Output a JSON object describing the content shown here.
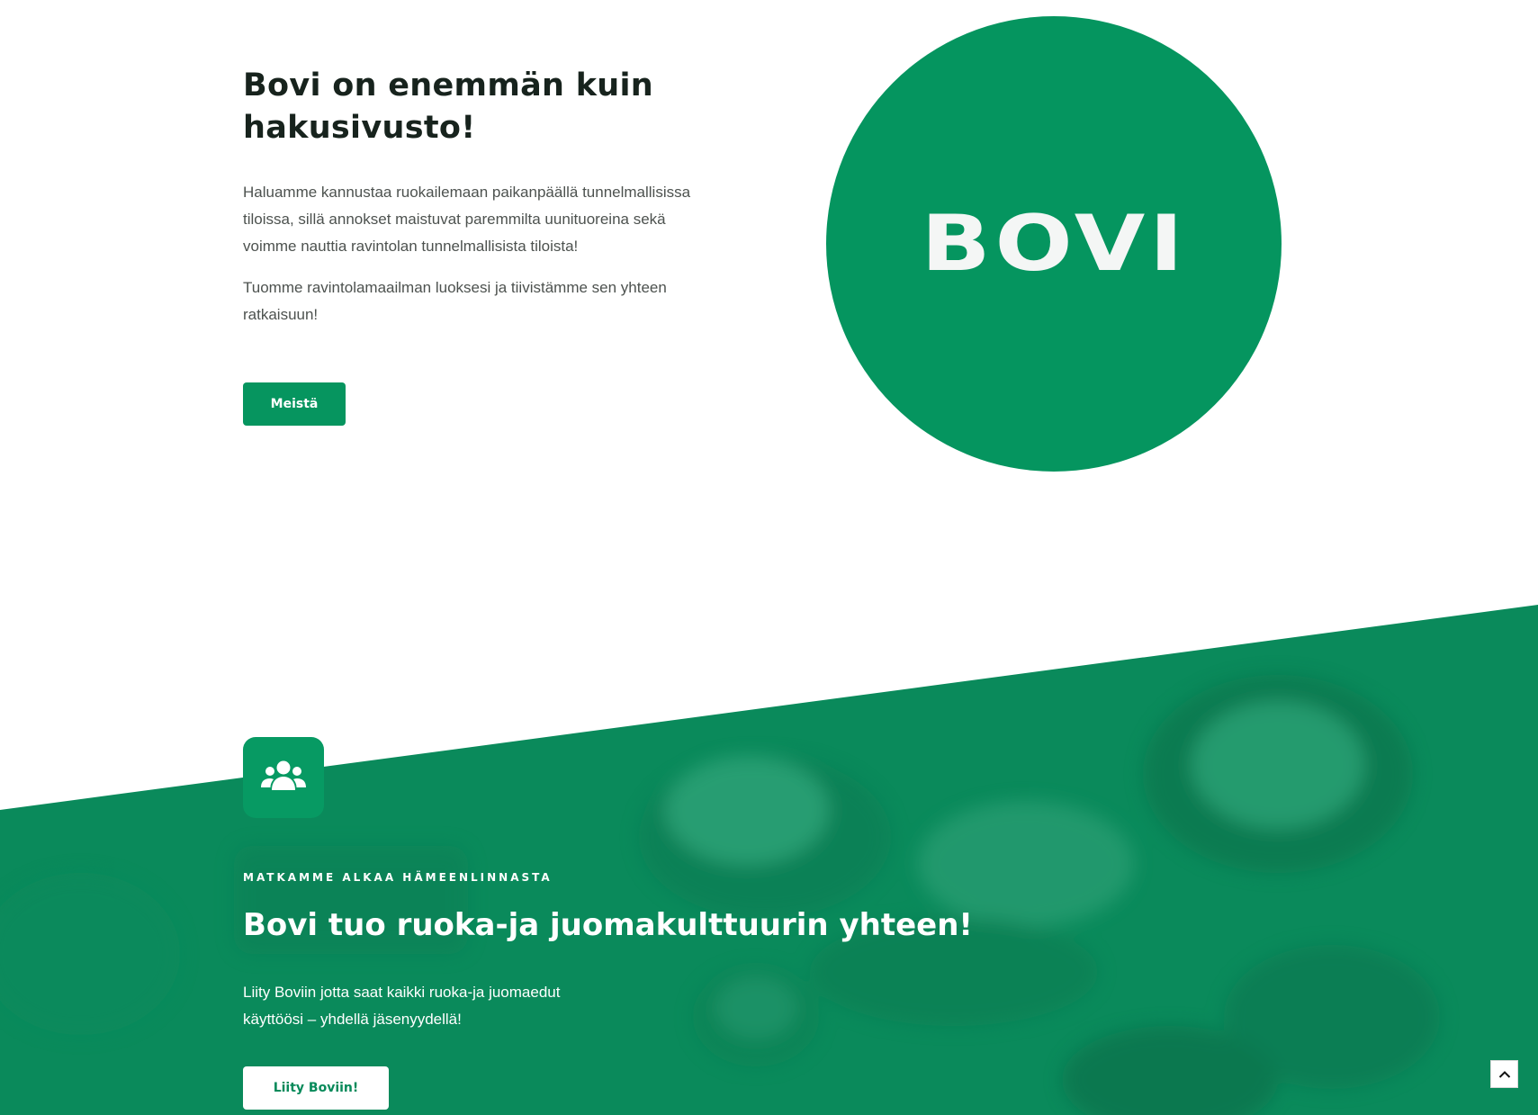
{
  "intro": {
    "heading": "Bovi on enemmän kuin hakusivusto!",
    "paragraph_1": "Haluamme kannustaa ruokailemaan paikanpäällä tunnelmallisissa tiloissa, sillä annokset maistuvat paremmilta uunituoreina sekä voimme nauttia ravintolan tunnelmallisista tiloista!",
    "paragraph_2": "Tuomme ravintolamaailman luoksesi ja tiivistämme sen yhteen ratkaisuun!",
    "button_label": "Meistä"
  },
  "logo": {
    "text": "BOVI",
    "color": "#05955f"
  },
  "join_section": {
    "icon": "users-icon",
    "eyebrow": "MATKAMME ALKAA HÄMEENLINNASTA",
    "heading": "Bovi tuo ruoka-ja juomakulttuurin yhteen!",
    "body": "Liity Boviin jotta saat kaikki ruoka-ja juomaedut käyttöösi – yhdellä jäsenyydellä!",
    "button_label": "Liity Boviin!",
    "background_color": "#0a8a5b"
  },
  "scroll_top": {
    "icon": "chevron-up-icon"
  }
}
